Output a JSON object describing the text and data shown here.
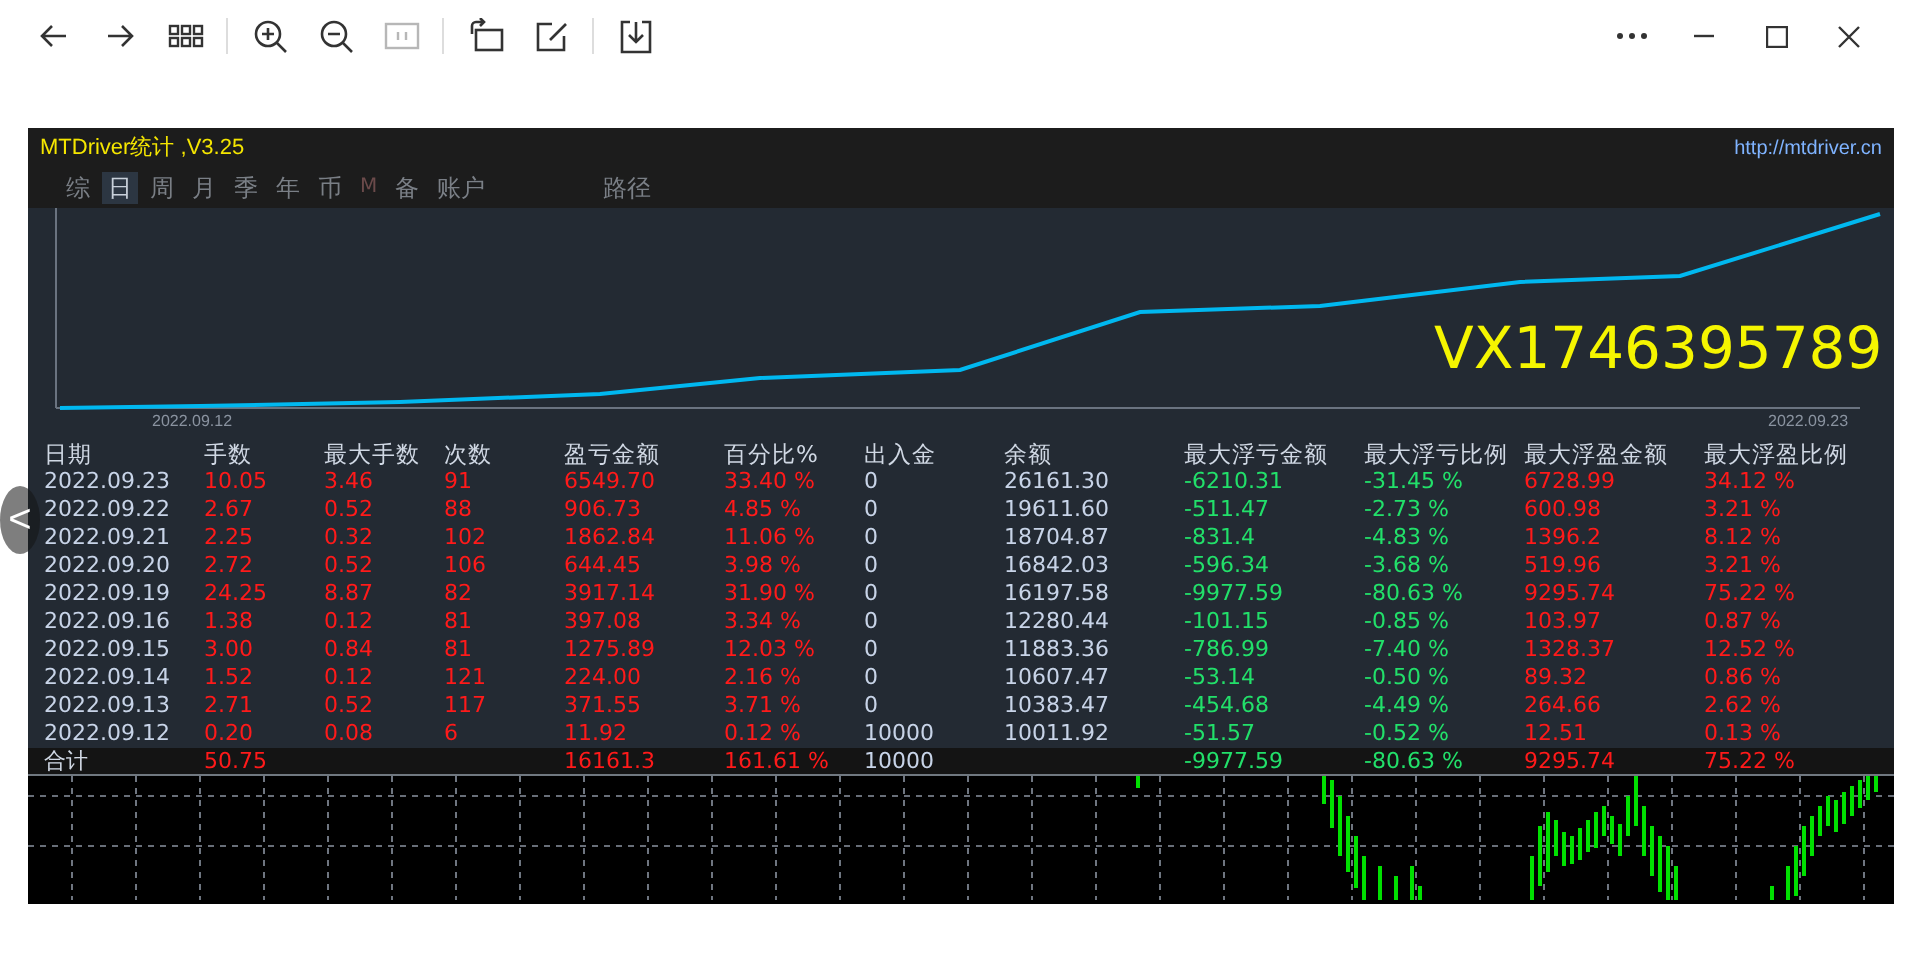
{
  "viewer_toolbar": {
    "left": [
      {
        "kind": "back",
        "disabled": false
      },
      {
        "kind": "forward",
        "disabled": false
      },
      {
        "kind": "grid",
        "disabled": false
      },
      {
        "kind": "sep"
      },
      {
        "kind": "zoomin",
        "disabled": false
      },
      {
        "kind": "zoomout",
        "disabled": false
      },
      {
        "kind": "actual",
        "disabled": true
      },
      {
        "kind": "sep"
      },
      {
        "kind": "rotate",
        "disabled": false
      },
      {
        "kind": "edit",
        "disabled": false
      },
      {
        "kind": "sep"
      },
      {
        "kind": "save",
        "disabled": false
      }
    ],
    "right": [
      {
        "kind": "more"
      },
      {
        "kind": "minimize"
      },
      {
        "kind": "maximize"
      },
      {
        "kind": "close"
      }
    ]
  },
  "app": {
    "title": "MTDriver统计 ,V3.25",
    "link": "http://mtdriver.cn",
    "tabs": [
      {
        "label": "综",
        "selected": false,
        "dim": false
      },
      {
        "label": "日",
        "selected": true,
        "dim": false
      },
      {
        "label": "周",
        "selected": false,
        "dim": false
      },
      {
        "label": "月",
        "selected": false,
        "dim": false
      },
      {
        "label": "季",
        "selected": false,
        "dim": false
      },
      {
        "label": "年",
        "selected": false,
        "dim": false
      },
      {
        "label": "币",
        "selected": false,
        "dim": false
      },
      {
        "label": "M",
        "selected": false,
        "dim": true
      },
      {
        "label": "备",
        "selected": false,
        "dim": false
      },
      {
        "label": "账户",
        "selected": false,
        "dim": false
      },
      {
        "label": "路径",
        "selected": false,
        "dim": false
      }
    ],
    "equity_chart": {
      "start_label": "2022.09.12",
      "end_label": "2022.09.23",
      "overlay_text": "VX1746395789"
    },
    "table": {
      "columns": [
        {
          "label": "日期",
          "color": "#c8d4e8"
        },
        {
          "label": "手数",
          "color": "#ff1a1a"
        },
        {
          "label": "最大手数",
          "color": "#ff1a1a"
        },
        {
          "label": "次数",
          "color": "#ff1a1a"
        },
        {
          "label": "盈亏金额",
          "color": "#ff1a1a"
        },
        {
          "label": "百分比%",
          "color": "#ff1a1a"
        },
        {
          "label": "出入金",
          "color": "#c8d4e8"
        },
        {
          "label": "余额",
          "color": "#c8d4e8"
        },
        {
          "label": "最大浮亏金额",
          "color": "#22e06a"
        },
        {
          "label": "最大浮亏比例",
          "color": "#22e06a"
        },
        {
          "label": "最大浮盈金额",
          "color": "#ff1a1a"
        },
        {
          "label": "最大浮盈比例",
          "color": "#ff1a1a"
        }
      ],
      "rows": [
        [
          "2022.09.23",
          "10.05",
          "3.46",
          "91",
          "6549.70",
          "33.40 %",
          "0",
          "26161.30",
          "-6210.31",
          "-31.45 %",
          "6728.99",
          "34.12 %"
        ],
        [
          "2022.09.22",
          "2.67",
          "0.52",
          "88",
          "906.73",
          "4.85 %",
          "0",
          "19611.60",
          "-511.47",
          "-2.73 %",
          "600.98",
          "3.21 %"
        ],
        [
          "2022.09.21",
          "2.25",
          "0.32",
          "102",
          "1862.84",
          "11.06 %",
          "0",
          "18704.87",
          "-831.4",
          "-4.83 %",
          "1396.2",
          "8.12 %"
        ],
        [
          "2022.09.20",
          "2.72",
          "0.52",
          "106",
          "644.45",
          "3.98 %",
          "0",
          "16842.03",
          "-596.34",
          "-3.68 %",
          "519.96",
          "3.21 %"
        ],
        [
          "2022.09.19",
          "24.25",
          "8.87",
          "82",
          "3917.14",
          "31.90 %",
          "0",
          "16197.58",
          "-9977.59",
          "-80.63 %",
          "9295.74",
          "75.22 %"
        ],
        [
          "2022.09.16",
          "1.38",
          "0.12",
          "81",
          "397.08",
          "3.34 %",
          "0",
          "12280.44",
          "-101.15",
          "-0.85 %",
          "103.97",
          "0.87 %"
        ],
        [
          "2022.09.15",
          "3.00",
          "0.84",
          "81",
          "1275.89",
          "12.03 %",
          "0",
          "11883.36",
          "-786.99",
          "-7.40 %",
          "1328.37",
          "12.52 %"
        ],
        [
          "2022.09.14",
          "1.52",
          "0.12",
          "121",
          "224.00",
          "2.16 %",
          "0",
          "10607.47",
          "-53.14",
          "-0.50 %",
          "89.32",
          "0.86 %"
        ],
        [
          "2022.09.13",
          "2.71",
          "0.52",
          "117",
          "371.55",
          "3.71 %",
          "0",
          "10383.47",
          "-454.68",
          "-4.49 %",
          "264.66",
          "2.62 %"
        ],
        [
          "2022.09.12",
          "0.20",
          "0.08",
          "6",
          "11.92",
          "0.12 %",
          "10000",
          "10011.92",
          "-51.57",
          "-0.52 %",
          "12.51",
          "0.13 %"
        ]
      ],
      "total": {
        "c0": "合计",
        "c1": "50.75",
        "c4": "16161.3",
        "c5": "161.61 %",
        "c6": "10000",
        "c8": "-9977.59",
        "c9": "-80.63 %",
        "c10": "9295.74",
        "c11": "75.22 %"
      }
    }
  },
  "prev_button": {
    "label": "<"
  }
}
